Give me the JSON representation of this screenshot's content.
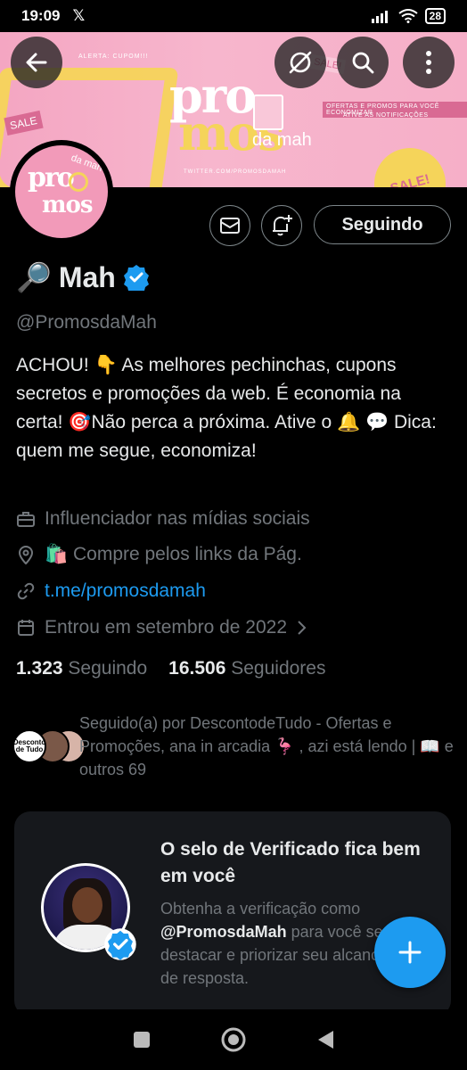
{
  "status_bar": {
    "time": "19:09",
    "x_logo": "𝕏",
    "battery": "28"
  },
  "banner": {
    "title_pro": "pro",
    "title_mos": "mos",
    "title_sub": "da mah",
    "tagline_1": "OFERTAS E PROMOS PARA VOCÊ ECONOMIZAR",
    "tagline_2": "ATIVE AS NOTIFICAÇÕES",
    "handle": "TWITTER.COM/PROMOSDAMAH",
    "alert_text": "ALERTA: CUPOM!!!",
    "sale_1": "SALE!",
    "sale_2": "SALE",
    "sale_3": "SALE!"
  },
  "avatar": {
    "pro": "pro",
    "mos": "mos",
    "da_mah": "da mah"
  },
  "profile": {
    "emoji": "🔎",
    "name": "Mah",
    "handle": "@PromosdaMah",
    "bio": "ACHOU! 👇 As melhores pechinchas, cupons secretos e promoções da web. É economia na certa! 🎯Não perca a próxima. Ative o 🔔 💬 Dica: quem me segue, economiza!",
    "category": "Influenciador nas mídias sociais",
    "location": "🛍️ Compre pelos links da Pág.",
    "link": "t.me/promosdamah",
    "joined": "Entrou em setembro de 2022",
    "following_count": "1.323",
    "following_label": "Seguindo",
    "followers_count": "16.506",
    "followers_label": "Seguidores",
    "follow_button": "Seguindo"
  },
  "followed_by": {
    "text": "Seguido(a) por DescontodeTudo - Ofertas e Promoções, ana in arcadia 🦩 , azi está lendo | 📖 e outros 69",
    "avatar_1_text": "Desconto de Tudo"
  },
  "verify_card": {
    "title": "O selo de Verificado fica bem em você",
    "desc_prefix": "Obtenha a verificação como ",
    "desc_handle": "@PromosdaMah",
    "desc_suffix": " para você se destacar e priorizar seu alcance de resposta."
  },
  "colors": {
    "accent": "#1d9bf0",
    "background": "#000000",
    "muted": "#71767b",
    "banner_pink": "#f7b6cd",
    "banner_yellow": "#f5d45a"
  }
}
